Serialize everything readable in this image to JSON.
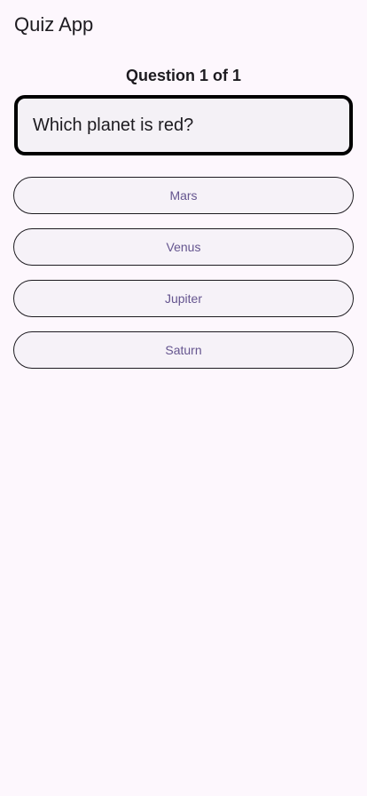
{
  "app_bar": {
    "title": "Quiz App"
  },
  "quiz": {
    "counter": "Question 1 of 1",
    "question": "Which planet is red?",
    "answers": [
      {
        "label": "Mars"
      },
      {
        "label": "Venus"
      },
      {
        "label": "Jupiter"
      },
      {
        "label": "Saturn"
      }
    ]
  },
  "colors": {
    "background": "#fdf7fd",
    "answer_text": "#65558f",
    "card_border": "#000000"
  }
}
